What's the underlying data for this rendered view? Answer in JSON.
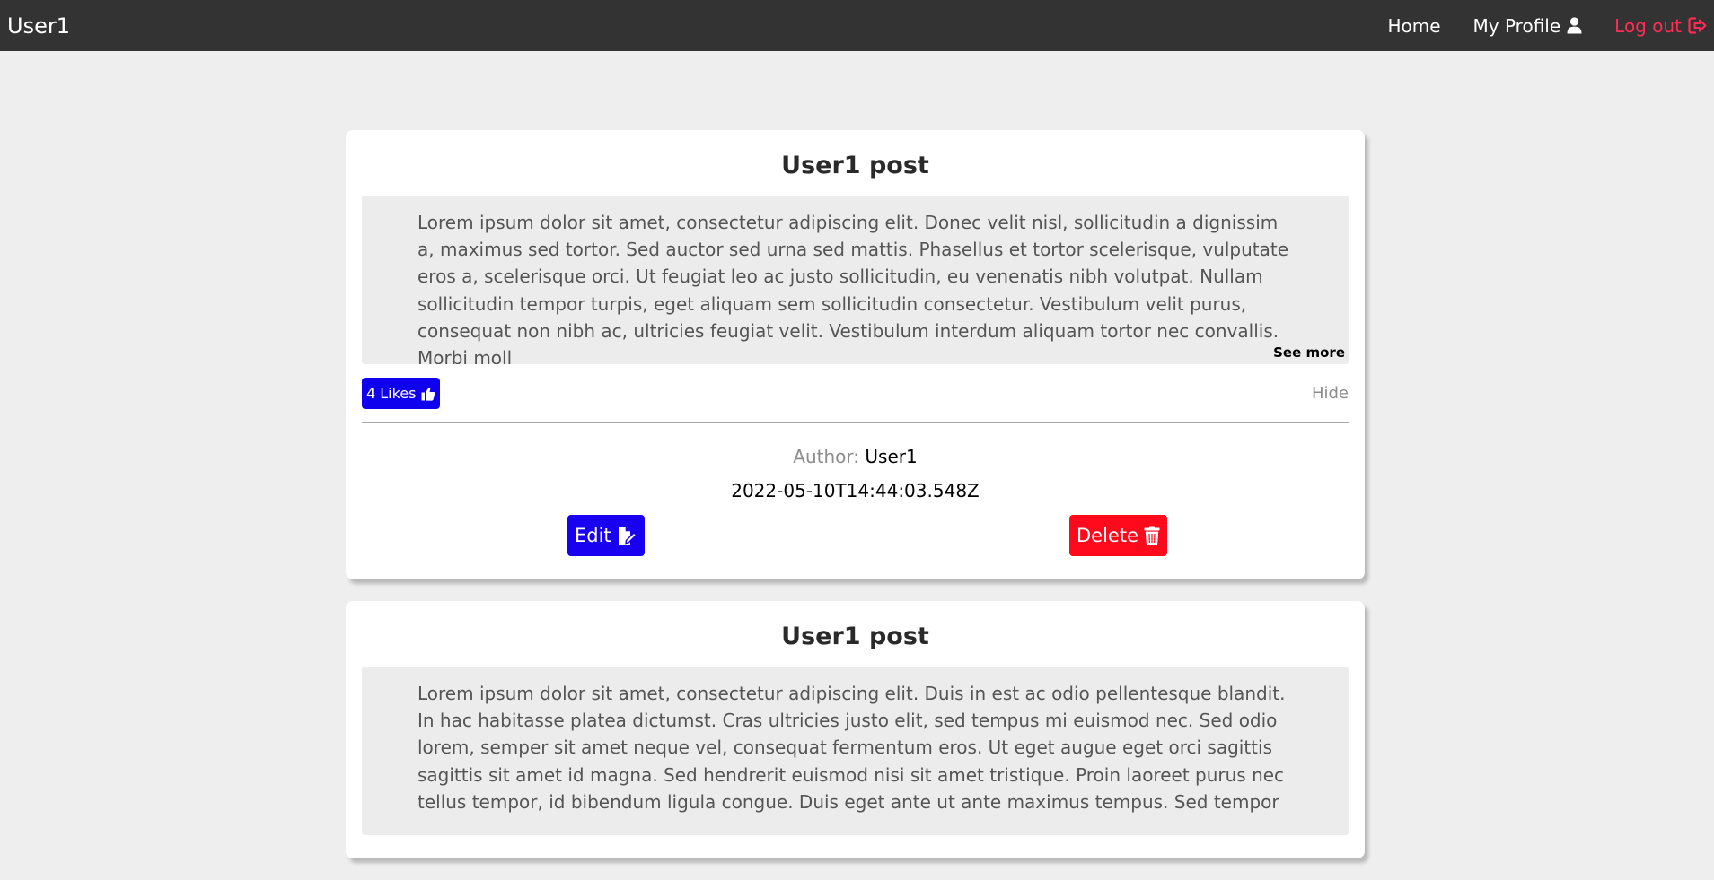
{
  "navbar": {
    "brand": "User1",
    "home": "Home",
    "profile": "My Profile",
    "logout": "Log out"
  },
  "posts": [
    {
      "title": "User1 post",
      "body": "Lorem ipsum dolor sit amet, consectetur adipiscing elit. Donec velit nisl, sollicitudin a dignissim a, maximus sed tortor. Sed auctor sed urna sed mattis. Phasellus et tortor scelerisque, vulputate eros a, scelerisque orci. Ut feugiat leo ac justo sollicitudin, eu venenatis nibh volutpat. Nullam sollicitudin tempor turpis, eget aliquam sem sollicitudin consectetur. Vestibulum velit purus, consequat non nibh ac, ultricies feugiat velit. Vestibulum interdum aliquam tortor nec convallis. Morbi moll",
      "see_more": "See more",
      "likes": "4 Likes",
      "hide": "Hide",
      "author_label": "Author:",
      "author": "User1",
      "date": "2022-05-10T14:44:03.548Z",
      "edit": "Edit",
      "delete": "Delete"
    },
    {
      "title": "User1 post",
      "body": "Lorem ipsum dolor sit amet, consectetur adipiscing elit. Duis in est ac odio pellentesque blandit. In hac habitasse platea dictumst. Cras ultricies justo elit, sed tempus mi euismod nec. Sed odio lorem, semper sit amet neque vel, consequat fermentum eros. Ut eget augue eget orci sagittis sagittis sit amet id magna. Sed hendrerit euismod nisi sit amet tristique. Proin laoreet purus nec tellus tempor, id bibendum ligula congue. Duis eget ante ut ante maximus tempus. Sed tempor"
    }
  ],
  "colors": {
    "navbar": "#333333",
    "logout": "#ff2d55",
    "likes": "#0f00ee",
    "edit": "#1a00f0",
    "delete": "#ff0a1c"
  }
}
